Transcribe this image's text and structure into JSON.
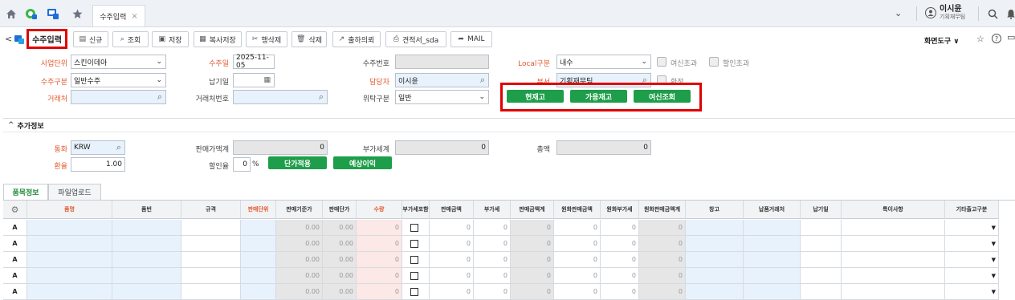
{
  "topbar": {
    "tab_label": "수주입력",
    "tab_close": "×",
    "user_name": "이시윤",
    "user_dept": "기획재무팀",
    "chevron": "⌄",
    "icons": [
      "home-icon",
      "app-icon-1",
      "app-icon-2",
      "star-icon",
      "search-icon",
      "bell-icon",
      "user-icon"
    ]
  },
  "toolbar": {
    "back": "<",
    "title": "수주입력",
    "buttons": [
      {
        "icon": "▤",
        "label": "신규"
      },
      {
        "icon": "⌕",
        "label": "조회"
      },
      {
        "icon": "▣",
        "label": "저장"
      },
      {
        "icon": "▦",
        "label": "복사저장"
      },
      {
        "icon": "✂",
        "label": "행삭제"
      },
      {
        "icon": "🗑",
        "label": "삭제"
      },
      {
        "icon": "↗",
        "label": "출하의뢰"
      },
      {
        "icon": "⎙",
        "label": "견적서_sda"
      },
      {
        "icon": "➦",
        "label": "MAIL"
      }
    ],
    "screen_tools": "화면도구",
    "screen_tools_caret": "∨",
    "right_icons": [
      "☆",
      "?",
      "▭"
    ]
  },
  "form": {
    "business_unit_label": "사업단위",
    "business_unit_value": "스킨이데아",
    "order_date_label": "수주일",
    "order_date_value": "2025-11-05",
    "order_no_label": "수주번호",
    "order_no_value": "",
    "local_type_label": "Local구분",
    "local_type_value": "내수",
    "credit_over_label": "여신초과",
    "discount_over_label": "할인초과",
    "order_type_label": "수주구분",
    "order_type_value": "일반수주",
    "delivery_date_label": "납기일",
    "manager_label": "담당자",
    "manager_value": "이시윤",
    "dept_label": "부서",
    "dept_value": "기획재무팀",
    "confirm_label": "확정",
    "customer_label": "거래처",
    "customer_no_label": "거래처번호",
    "consign_type_label": "위탁구분",
    "consign_type_value": "일반",
    "btn_stock": "현재고",
    "btn_available_stock": "가용재고",
    "btn_credit_check": "여신조회"
  },
  "extra": {
    "section_title": "추가정보",
    "section_caret": "^",
    "currency_label": "통화",
    "currency_value": "KRW",
    "sales_total_label": "판매가액계",
    "sales_total_value": "0",
    "vat_total_label": "부가세계",
    "vat_total_value": "0",
    "total_label": "총액",
    "total_value": "0",
    "exchange_label": "환율",
    "exchange_value": "1.00",
    "discount_rate_label": "할인율",
    "discount_rate_value": "0",
    "discount_rate_unit": "%",
    "btn_apply_price": "단가적용",
    "btn_expected_profit": "예상이익"
  },
  "grid_tabs": [
    "품목정보",
    "파일업로드"
  ],
  "grid": {
    "headers": [
      "품명",
      "품번",
      "규격",
      "판매단위",
      "판매기준가",
      "판매단가",
      "수량",
      "부가세포함",
      "판매금액",
      "부가세",
      "판매금액계",
      "원화판매금액",
      "원화부가세",
      "원화판매금액계",
      "창고",
      "납품거래처",
      "납기일",
      "특이사항",
      "기타출고구분"
    ],
    "row_marker": "A",
    "row_values": {
      "std_price": "0.00",
      "unit_price": "0.00",
      "qty": "0",
      "sales_amt": "0",
      "vat": "0",
      "sales_total": "0",
      "krw_amt": "0",
      "krw_vat": "0",
      "krw_total": "0"
    },
    "dropdown_arrow": "▼",
    "gear": "⚙"
  },
  "colors": {
    "accent_green": "#1e9e4a",
    "required_label": "#e05a2e",
    "highlight_red": "#e00000",
    "field_blue": "#e8f2fc"
  }
}
